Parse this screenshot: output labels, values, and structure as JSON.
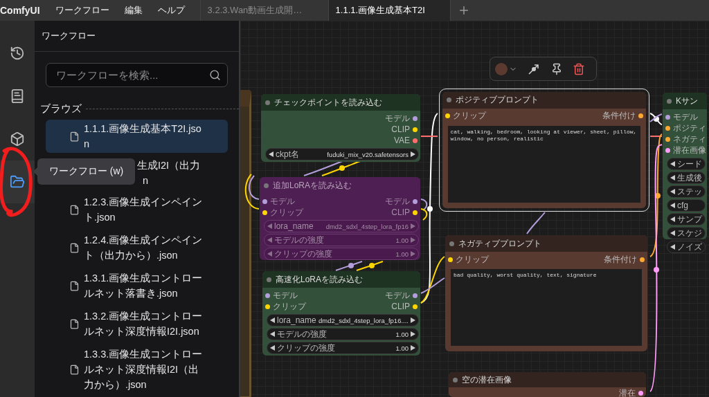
{
  "menubar": {
    "logo": "ComfyUI",
    "menus": [
      "ワークフロー",
      "編集",
      "ヘルプ"
    ]
  },
  "tabs": [
    {
      "label": "3.2.3.Wan動画生成開…",
      "selected": false
    },
    {
      "label": "1.1.1.画像生成基本T2I",
      "selected": true
    }
  ],
  "sidebar_icons": [
    {
      "kind": "history",
      "selected": false,
      "annotated": false
    },
    {
      "kind": "book",
      "selected": false,
      "annotated": false
    },
    {
      "kind": "cube",
      "selected": false,
      "annotated": false
    },
    {
      "kind": "folder",
      "selected": true,
      "annotated": true
    }
  ],
  "tooltip": "ワークフロー (w)",
  "panel": {
    "title": "ワークフロー",
    "search": {
      "placeholder": "ワークフローを検索..."
    },
    "section": "ブラウズ",
    "files": [
      {
        "kind": "file",
        "label": "1.1.1.画像生成基本T2I.json",
        "selected": true
      },
      {
        "kind": "covered",
        "lines": [
          "生成I2I（出力",
          "n"
        ],
        "selected": false
      },
      {
        "kind": "file",
        "label": "1.2.3.画像生成インペイント.json",
        "selected": false
      },
      {
        "kind": "file",
        "label": "1.2.4.画像生成インペイント（出力から）.json",
        "selected": false
      },
      {
        "kind": "file",
        "label": "1.3.1.画像生成コントロールネット落書き.json",
        "selected": false
      },
      {
        "kind": "file",
        "label": "1.3.2.画像生成コントロールネット深度情報I2I.json",
        "selected": false
      },
      {
        "kind": "file",
        "label": "1.3.3.画像生成コントロールネット深度情報I2I（出力から）.json",
        "selected": false
      }
    ]
  },
  "canvas": {
    "nodes": [
      {
        "title": "チェックポイントを読み込む",
        "kind": "green",
        "bypassed": false,
        "selected": false,
        "outputs": [
          {
            "label": "モデル",
            "color": "#b39ddb"
          },
          {
            "label": "CLIP",
            "color": "#ffd500"
          },
          {
            "label": "VAE",
            "color": "#ff6e6e"
          }
        ],
        "widgets": [
          {
            "label": "ckpt名",
            "value": "fuduki_mix_v20.safetensors"
          }
        ]
      },
      {
        "title": "追加LoRAを読み込む",
        "kind": "purple",
        "bypassed": true,
        "selected": false,
        "inputs": [
          {
            "label": "モデル",
            "color": "#b39ddb"
          },
          {
            "label": "クリップ",
            "color": "#ffd500"
          }
        ],
        "outputs": [
          {
            "label": "モデル",
            "color": "#b39ddb"
          },
          {
            "label": "CLIP",
            "color": "#ffd500"
          }
        ],
        "widgets": [
          {
            "label": "lora_name",
            "value": "dmd2_sdxl_4step_lora_fp16"
          },
          {
            "label": "モデルの強度",
            "value": "1.00"
          },
          {
            "label": "クリップの強度",
            "value": "1.00"
          }
        ]
      },
      {
        "title": "高速化LoRAを読み込む",
        "kind": "green",
        "bypassed": false,
        "selected": false,
        "inputs": [
          {
            "label": "モデル",
            "color": "#b39ddb"
          },
          {
            "label": "クリップ",
            "color": "#ffd500"
          }
        ],
        "outputs": [
          {
            "label": "モデル",
            "color": "#b39ddb"
          },
          {
            "label": "CLIP",
            "color": "#ffd500"
          }
        ],
        "widgets": [
          {
            "label": "lora_name",
            "value": "dmd2_sdxl_4step_lora_fp16...."
          },
          {
            "label": "モデルの強度",
            "value": "1.00"
          },
          {
            "label": "クリップの強度",
            "value": "1.00"
          }
        ]
      },
      {
        "title": "ポジティブプロンプト",
        "kind": "brown",
        "bypassed": false,
        "selected": true,
        "inputs": [
          {
            "label": "クリップ",
            "color": "#ffd500"
          }
        ],
        "outputs": [
          {
            "label": "条件付け",
            "color": "#ffa931"
          }
        ],
        "text": "cat, walking, bedroom, looking at viewer, sheet, pillow, window, no person, realistic"
      },
      {
        "title": "ネガティブプロンプト",
        "kind": "brown",
        "bypassed": false,
        "selected": false,
        "inputs": [
          {
            "label": "クリップ",
            "color": "#ffd500"
          }
        ],
        "outputs": [
          {
            "label": "条件付け",
            "color": "#ffa931"
          }
        ],
        "text": "bad quality, worst quality, text, signature"
      },
      {
        "title": "Kサン",
        "kind": "green",
        "bypassed": false,
        "selected": false,
        "inputs": [
          {
            "label": "モデル",
            "color": "#b39ddb"
          },
          {
            "label": "ポジティ",
            "color": "#ffa931"
          },
          {
            "label": "ネガティ",
            "color": "#ffa931"
          },
          {
            "label": "潜在画像",
            "color": "#ff9cf9"
          }
        ],
        "widgets": [
          {
            "label": "シード"
          },
          {
            "label": "生成後"
          },
          {
            "label": "ステッ"
          },
          {
            "label": "cfg"
          },
          {
            "label": "サンプ"
          },
          {
            "label": "スケジ"
          },
          {
            "label": "ノイズ"
          }
        ]
      },
      {
        "title": "空の潜在画像",
        "kind": "brown",
        "bypassed": false,
        "selected": false,
        "outputs": [
          {
            "label": "潜在",
            "color": "#ff9cf9"
          }
        ]
      }
    ]
  }
}
